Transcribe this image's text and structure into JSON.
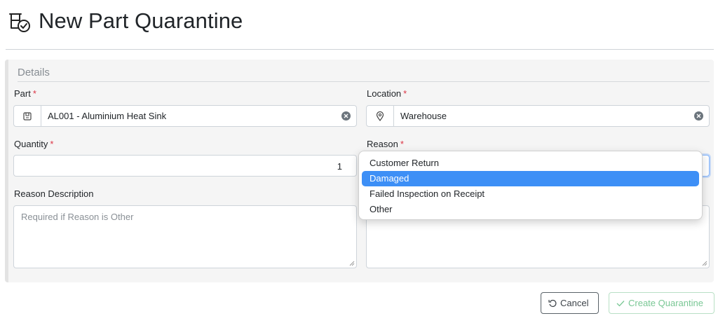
{
  "page": {
    "title": "New Part Quarantine",
    "icon": "quarantine-icon"
  },
  "details": {
    "title": "Details",
    "required_marker": "*",
    "part": {
      "label": "Part",
      "value": "AL001 - Aluminium Heat Sink",
      "icon": "box-icon"
    },
    "location": {
      "label": "Location",
      "value": "Warehouse",
      "icon": "map-pin-icon"
    },
    "quantity": {
      "label": "Quantity",
      "value": "1"
    },
    "reason": {
      "label": "Reason",
      "options": [
        "Customer Return",
        "Damaged",
        "Failed Inspection on Receipt",
        "Other"
      ],
      "highlighted": "Damaged"
    },
    "reason_description": {
      "label": "Reason Description",
      "placeholder": "Required if Reason is Other"
    }
  },
  "actions": {
    "cancel": "Cancel",
    "create": "Create Quarantine"
  },
  "colors": {
    "required": "#dc3545",
    "highlight": "#3d8ff6",
    "create_disabled": "#79c794"
  }
}
